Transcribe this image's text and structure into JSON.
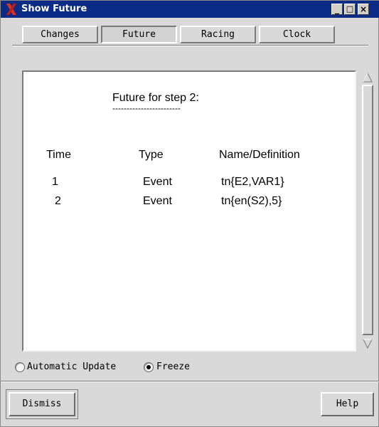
{
  "window": {
    "title": "Show Future",
    "controls": [
      "_",
      "□",
      "×"
    ]
  },
  "colors": {
    "titlebar": "#0b2b86",
    "app_icon": "#e0301e",
    "window_bg": "#d9d9d9",
    "panel_bg": "#ffffff"
  },
  "tabs": [
    {
      "label": "Changes",
      "selected": false
    },
    {
      "label": "Future",
      "selected": true
    },
    {
      "label": "Racing",
      "selected": false
    },
    {
      "label": "Clock",
      "selected": false
    }
  ],
  "panel": {
    "heading": "Future for step 2:",
    "underline": "------------------------",
    "columns": [
      "Time",
      "Type",
      "Name/Definition"
    ],
    "rows": [
      {
        "time": "1",
        "type": "Event",
        "name": "tn{E2,VAR1}"
      },
      {
        "time": "2",
        "type": "Event",
        "name": "tn{en(S2),5}"
      }
    ]
  },
  "update_mode": {
    "options": [
      "Automatic Update",
      "Freeze"
    ],
    "selected": "Freeze"
  },
  "buttons": {
    "dismiss": "Dismiss",
    "help": "Help"
  },
  "icons": {
    "app": "x-logo-icon",
    "scroll_up": "triangle-up-icon",
    "scroll_down": "triangle-down-icon"
  }
}
